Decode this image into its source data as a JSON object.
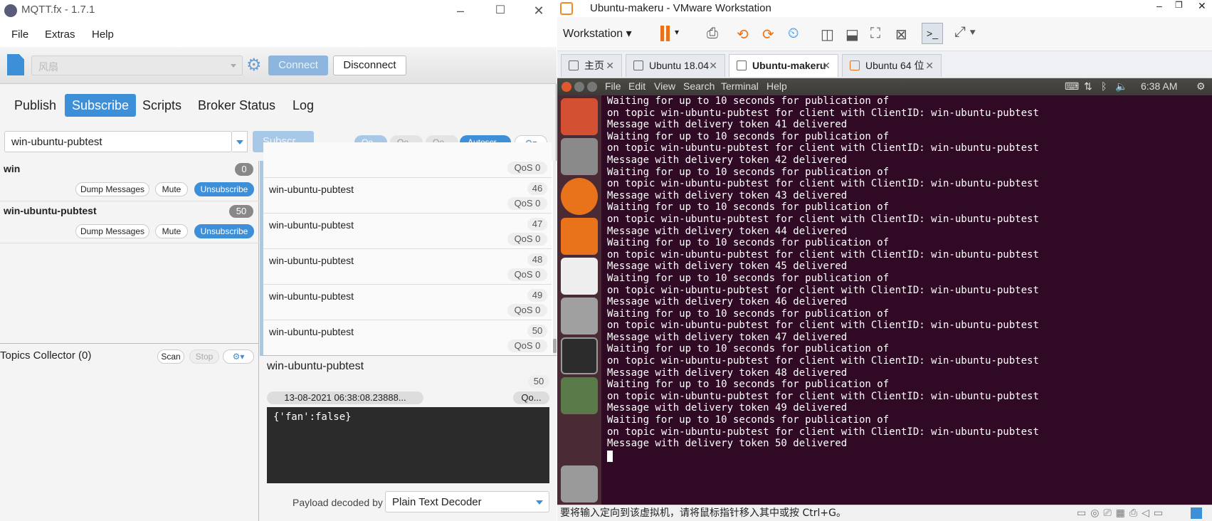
{
  "mqtt": {
    "window_title": "MQTT.fx - 1.7.1",
    "menu": [
      "File",
      "Extras",
      "Help"
    ],
    "profile": "风扇",
    "connect_label": "Connect",
    "disconnect_label": "Disconnect",
    "tabs": [
      "Publish",
      "Subscribe",
      "Scripts",
      "Broker Status",
      "Log"
    ],
    "topic_input": "win-ubuntu-pubtest",
    "subscribe_label": "Subscr...",
    "qos_pills": [
      "Qo...",
      "Qo...",
      "Qo..."
    ],
    "autoscroll_label": "Autoscr...",
    "subscriptions": [
      {
        "name": "win",
        "count": "0"
      },
      {
        "name": "win-ubuntu-pubtest",
        "count": "50"
      }
    ],
    "dump_label": "Dump Messages",
    "mute_label": "Mute",
    "unsubscribe_label": "Unsubscribe",
    "topics_collector": {
      "title": "Topics Collector (0)",
      "scan": "Scan",
      "stop": "Stop"
    },
    "first_row_qos": "QoS 0",
    "messages": [
      {
        "topic": "win-ubuntu-pubtest",
        "num": "46",
        "qos": "QoS 0"
      },
      {
        "topic": "win-ubuntu-pubtest",
        "num": "47",
        "qos": "QoS 0"
      },
      {
        "topic": "win-ubuntu-pubtest",
        "num": "48",
        "qos": "QoS 0"
      },
      {
        "topic": "win-ubuntu-pubtest",
        "num": "49",
        "qos": "QoS 0"
      },
      {
        "topic": "win-ubuntu-pubtest",
        "num": "50",
        "qos": "QoS 0"
      }
    ],
    "detail": {
      "topic": "win-ubuntu-pubtest",
      "num": "50",
      "timestamp": "13-08-2021  06:38:08.23888...",
      "qos": "Qo...",
      "payload": "{'fan':false}",
      "decoder_label": "Payload decoded by",
      "decoder_value": "Plain Text Decoder"
    }
  },
  "vmware": {
    "window_title": "Ubuntu-makeru - VMware Workstation",
    "workstation_menu": "Workstation",
    "tabs": [
      "主页",
      "Ubuntu 18.04",
      "Ubuntu-makeru",
      "Ubuntu 64 位"
    ],
    "ubuntu_menu": [
      "File",
      "Edit",
      "View",
      "Search",
      "Terminal",
      "Help"
    ],
    "clock": "6:38 AM",
    "status_text": "要将输入定向到该虚拟机，请将鼠标指针移入其中或按 Ctrl+G。",
    "terminal_lines": [
      "Waiting for up to 10 seconds for publication of",
      "on topic win-ubuntu-pubtest for client with ClientID: win-ubuntu-pubtest",
      "Message with delivery token 41 delivered",
      "Waiting for up to 10 seconds for publication of",
      "on topic win-ubuntu-pubtest for client with ClientID: win-ubuntu-pubtest",
      "Message with delivery token 42 delivered",
      "Waiting for up to 10 seconds for publication of",
      "on topic win-ubuntu-pubtest for client with ClientID: win-ubuntu-pubtest",
      "Message with delivery token 43 delivered",
      "Waiting for up to 10 seconds for publication of",
      "on topic win-ubuntu-pubtest for client with ClientID: win-ubuntu-pubtest",
      "Message with delivery token 44 delivered",
      "Waiting for up to 10 seconds for publication of",
      "on topic win-ubuntu-pubtest for client with ClientID: win-ubuntu-pubtest",
      "Message with delivery token 45 delivered",
      "Waiting for up to 10 seconds for publication of",
      "on topic win-ubuntu-pubtest for client with ClientID: win-ubuntu-pubtest",
      "Message with delivery token 46 delivered",
      "Waiting for up to 10 seconds for publication of",
      "on topic win-ubuntu-pubtest for client with ClientID: win-ubuntu-pubtest",
      "Message with delivery token 47 delivered",
      "Waiting for up to 10 seconds for publication of",
      "on topic win-ubuntu-pubtest for client with ClientID: win-ubuntu-pubtest",
      "Message with delivery token 48 delivered",
      "Waiting for up to 10 seconds for publication of",
      "on topic win-ubuntu-pubtest for client with ClientID: win-ubuntu-pubtest",
      "Message with delivery token 49 delivered",
      "Waiting for up to 10 seconds for publication of",
      "on topic win-ubuntu-pubtest for client with ClientID: win-ubuntu-pubtest",
      "Message with delivery token 50 delivered"
    ]
  }
}
